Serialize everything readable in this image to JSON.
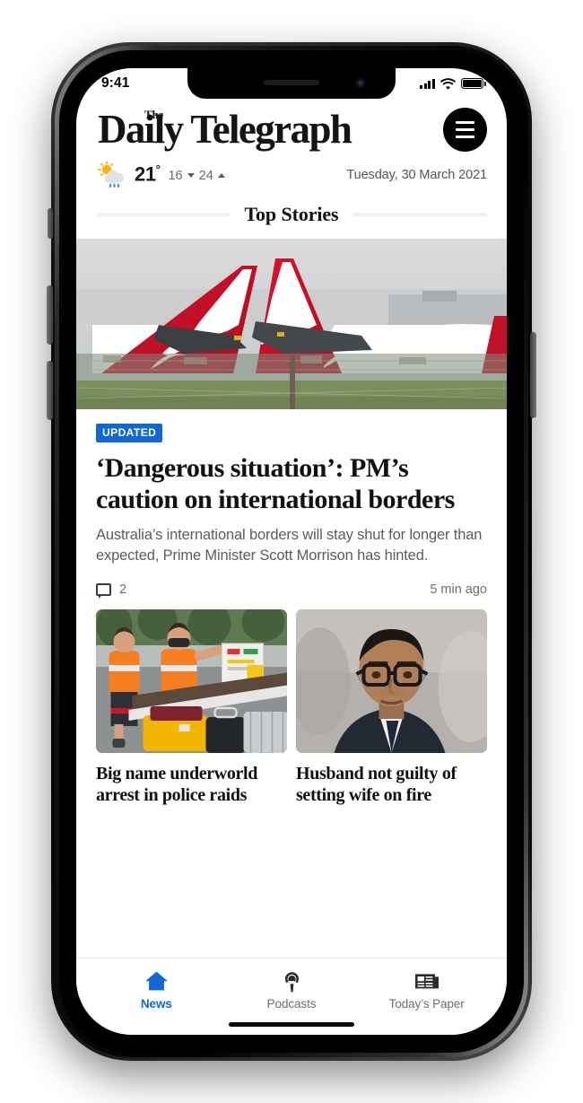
{
  "status_bar": {
    "time": "9:41",
    "signal_icon": "cellular-signal-icon",
    "wifi_icon": "wifi-icon",
    "battery_icon": "battery-full-icon"
  },
  "masthead": {
    "logo_the": "The",
    "logo_main": "Daily Telegraph",
    "menu_icon": "hamburger-menu-icon"
  },
  "weather": {
    "icon": "sun-behind-rain-cloud-icon",
    "current_temp": "21",
    "degree_symbol": "°",
    "min_temp": "16",
    "max_temp": "24"
  },
  "date": "Tuesday, 30 March 2021",
  "section": {
    "title": "Top Stories"
  },
  "lead_story": {
    "image_alt": "qantas-tail-fins-photo",
    "badge": "UPDATED",
    "badge_color": "#1267d8",
    "headline": "‘Dangerous situation’: PM’s caution on international borders",
    "standfirst": "Australia’s international borders will stay shut for longer than expected, Prime Minister Scott Morrison has hinted.",
    "comment_icon": "comment-bubble-icon",
    "comment_count": "2",
    "timestamp": "5 min ago"
  },
  "cards": [
    {
      "image_alt": "baggage-handlers-loading-luggage-photo",
      "title": "Big name underworld arrest in police raids"
    },
    {
      "image_alt": "man-in-glasses-and-suit-portrait-photo",
      "title": "Husband not guilty of setting wife on fire"
    }
  ],
  "tabs": [
    {
      "icon": "home-icon",
      "label": "News",
      "active": true
    },
    {
      "icon": "podcast-microphone-icon",
      "label": "Podcasts",
      "active": false
    },
    {
      "icon": "newspaper-icon",
      "label": "Today’s Paper",
      "active": false
    }
  ]
}
